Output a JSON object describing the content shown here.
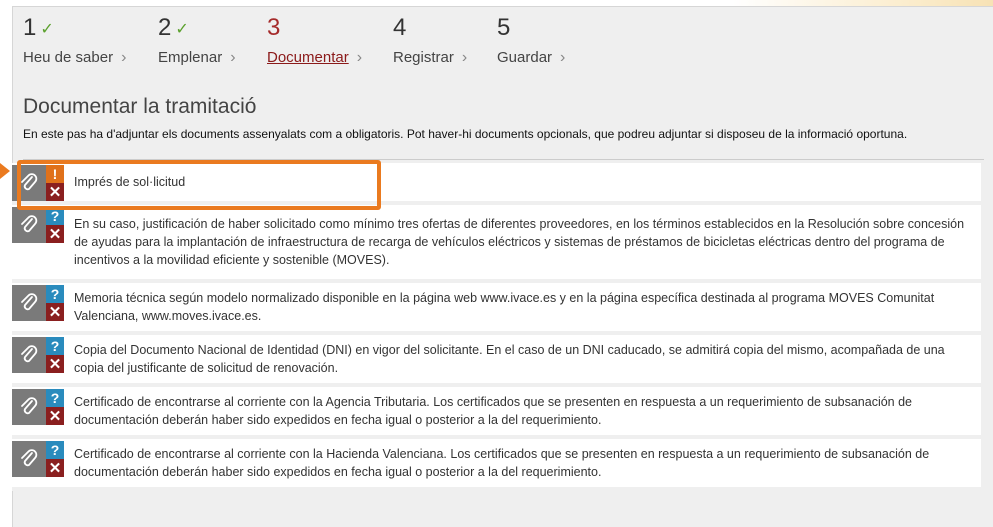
{
  "steps": [
    {
      "num": "1",
      "done": true,
      "label": "Heu de saber",
      "active": false
    },
    {
      "num": "2",
      "done": true,
      "label": "Emplenar",
      "active": false
    },
    {
      "num": "3",
      "done": false,
      "label": "Documentar",
      "active": true
    },
    {
      "num": "4",
      "done": false,
      "label": "Registrar",
      "active": false
    },
    {
      "num": "5",
      "done": false,
      "label": "Guardar",
      "active": false
    }
  ],
  "check_glyph": "✓",
  "chevron_glyph": "›",
  "section": {
    "title": "Documentar la tramitació",
    "description": "En este pas ha d'adjuntar els documents assenyalats com a obligatoris. Pot haver-hi documents opcionals, que podreu adjuntar si disposeu de la informació oportuna."
  },
  "documents": [
    {
      "status": "warn",
      "status_glyph": "!",
      "text": "Imprés de sol·licitud"
    },
    {
      "status": "info",
      "status_glyph": "?",
      "text": "En su caso, justificación de haber solicitado como mínimo tres ofertas de diferentes proveedores, en los términos establecidos en la Resolución sobre concesión de ayudas para la implantación de infraestructura de recarga de vehículos eléctricos y sistemas de préstamos de bicicletas eléctricas dentro del programa de incentivos a la movilidad eficiente y sostenible (MOVES)."
    },
    {
      "status": "info",
      "status_glyph": "?",
      "text": "Memoria técnica según modelo normalizado disponible en la página web www.ivace.es y en la página específica destinada al programa MOVES Comunitat Valenciana, www.moves.ivace.es."
    },
    {
      "status": "info",
      "status_glyph": "?",
      "text": "Copia del Documento Nacional de Identidad (DNI) en vigor del solicitante. En el caso de un DNI caducado, se admitirá copia del mismo, acompañada de una copia del justificante de solicitud de renovación."
    },
    {
      "status": "info",
      "status_glyph": "?",
      "text": "Certificado de encontrarse al corriente con la Agencia Tributaria. Los certificados que se presenten en respuesta a un requerimiento de subsanación de documentación deberán haber sido expedidos en fecha igual o posterior a la del requerimiento."
    },
    {
      "status": "info",
      "status_glyph": "?",
      "text": "Certificado de encontrarse al corriente con la Hacienda Valenciana. Los certificados que se presenten en respuesta a un requerimiento de subsanación de documentación deberán haber sido expedidos en fecha igual o posterior a la del requerimiento."
    }
  ],
  "delete_glyph": "✕",
  "colors": {
    "accent": "#ea7a1f",
    "active_step": "#a52a2a",
    "check": "#5aa02c",
    "warn": "#e0711a",
    "info": "#2a8bbd",
    "delete": "#8a1f1f"
  }
}
